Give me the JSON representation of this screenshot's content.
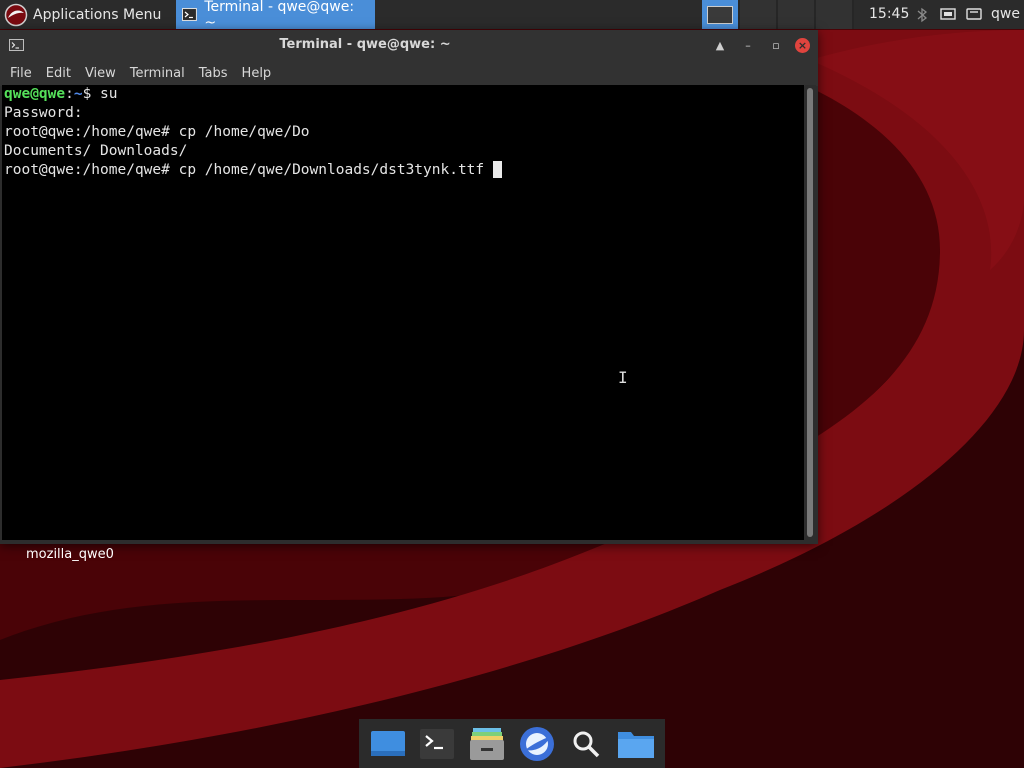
{
  "panel": {
    "apps_menu_label": "Applications Menu",
    "task_label": "Terminal - qwe@qwe: ~",
    "clock": "15:45",
    "user": "qwe"
  },
  "window": {
    "title": "Terminal - qwe@qwe: ~",
    "menu": [
      "File",
      "Edit",
      "View",
      "Terminal",
      "Tabs",
      "Help"
    ]
  },
  "terminal": {
    "prompt_user": "qwe@qwe",
    "prompt_path": "~",
    "line1_cmd": " su",
    "line2": "Password:",
    "line3": "root@qwe:/home/qwe# cp /home/qwe/Do",
    "line4": "Documents/ Downloads/",
    "line5": "root@qwe:/home/qwe# cp /home/qwe/Downloads/dst3tynk.ttf "
  },
  "desktop": {
    "icon_label": "mozilla_qwe0"
  },
  "dock_icons": [
    "show-desktop-icon",
    "terminal-icon",
    "file-manager-icon",
    "web-browser-icon",
    "search-icon",
    "folder-icon"
  ],
  "colors": {
    "panel": "#2b2b2b",
    "accent": "#4a8ed8",
    "wallpaper_dark": "#3d0306",
    "wallpaper_red": "#7a0a10",
    "prompt_user": "#55e05a",
    "prompt_path": "#4f87e6"
  }
}
